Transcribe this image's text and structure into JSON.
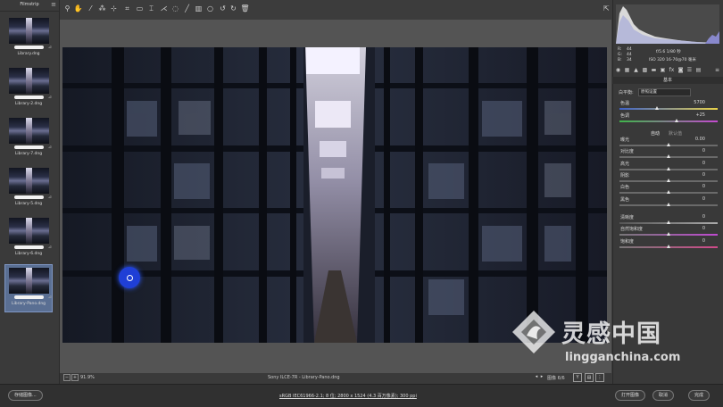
{
  "filmstrip": {
    "title": "Filmstrip",
    "items": [
      {
        "name": "Library.dng",
        "selected": false
      },
      {
        "name": "Library-2.dng",
        "selected": false
      },
      {
        "name": "Library-7.dng",
        "selected": false
      },
      {
        "name": "Library-5.dng",
        "selected": false
      },
      {
        "name": "Library-6.dng",
        "selected": false
      },
      {
        "name": "Library-Pano.dng",
        "selected": true
      }
    ]
  },
  "toolbar": {
    "tools": [
      "zoom-icon",
      "hand-icon",
      "white-balance-icon",
      "color-sampler-icon",
      "targeted-adjust-icon",
      "crop-icon",
      "straighten-icon",
      "transform-icon",
      "spot-removal-icon",
      "red-eye-icon",
      "adjustment-brush-icon",
      "graduated-filter-icon",
      "radial-filter-icon",
      "rotate-left-icon",
      "rotate-right-icon",
      "trash-icon"
    ],
    "share_icon": "open-preferences-icon"
  },
  "canvas": {
    "zoom_level": "91.9%",
    "filename_label": "Sony ILCE-7R - Library-Pano.dng",
    "image_count": "图像 6/6"
  },
  "histogram": {
    "r_label": "R:",
    "r_value": "44",
    "g_label": "G:",
    "g_value": "44",
    "b_label": "B:",
    "b_value": "34",
    "exif_line1": "f/5.6  1/80 秒",
    "exif_line2": "ISO 320  16-70@70 毫米"
  },
  "panel": {
    "title": "基本",
    "wb_label": "白平衡:",
    "wb_value": "原照设置",
    "temp_label": "色温",
    "temp_value": "5700",
    "tint_label": "色调",
    "tint_value": "+25",
    "tab_auto": "自动",
    "tab_default": "默认值",
    "sliders": [
      {
        "label": "曝光",
        "value": "0.00"
      },
      {
        "label": "对比度",
        "value": "0"
      },
      {
        "label": "高光",
        "value": "0"
      },
      {
        "label": "阴影",
        "value": "0"
      },
      {
        "label": "白色",
        "value": "0"
      },
      {
        "label": "黑色",
        "value": "0"
      },
      {
        "label": "清晰度",
        "value": "0"
      },
      {
        "label": "自然饱和度",
        "value": "0"
      },
      {
        "label": "饱和度",
        "value": "0"
      }
    ]
  },
  "footer": {
    "save_button": "存储图像...",
    "meta_line": "sRGB IEC61966-2.1; 8 位; 2800 x 1524 (4.3 百万像素); 300 ppi",
    "open_button": "打开图像",
    "cancel_button": "取消",
    "done_button": "完成"
  },
  "watermark": {
    "cn": "灵感中国",
    "en": "lingganchina.com"
  },
  "colors": {
    "selection": "#5a6f93",
    "panel_bg": "#393939",
    "canvas_bg": "#545454",
    "cursor_dot": "#1f3fd6"
  }
}
